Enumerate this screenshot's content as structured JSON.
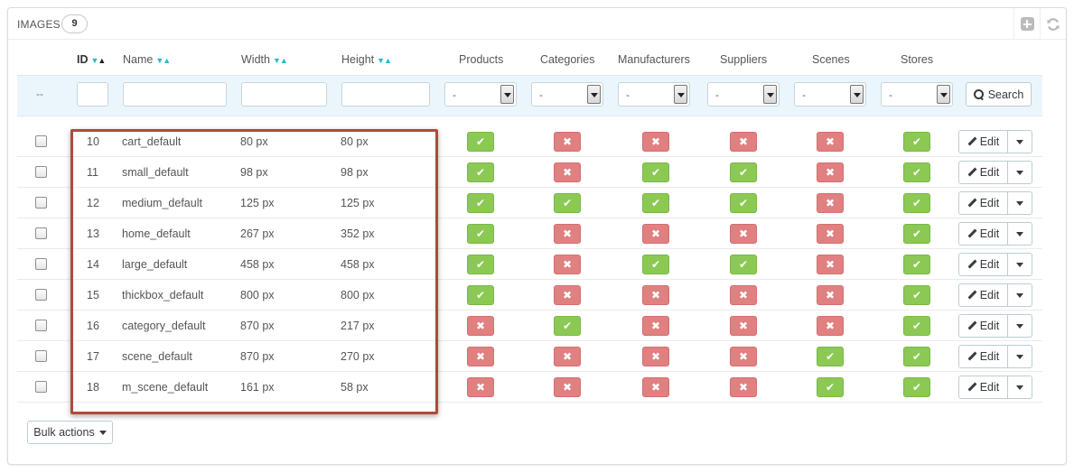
{
  "panel": {
    "title": "IMAGES",
    "count": "9"
  },
  "icons": {
    "add": "plus-icon",
    "refresh": "refresh-icon",
    "search": "search-icon",
    "edit": "pencil-icon",
    "yes": "check-icon",
    "no": "cross-icon"
  },
  "colors": {
    "yes": "#8bc954",
    "no": "#e08080",
    "highlight": "#b14a3a",
    "filter_bg": "#ebf6fc",
    "sort_arrow": "#25b9d7"
  },
  "columns": {
    "id": "ID",
    "name": "Name",
    "width": "Width",
    "height": "Height",
    "products": "Products",
    "categories": "Categories",
    "manufacturers": "Manufacturers",
    "suppliers": "Suppliers",
    "scenes": "Scenes",
    "stores": "Stores"
  },
  "sort_glyphs": {
    "desc": "▼",
    "asc": "▲"
  },
  "filters": {
    "placeholder_dash": "--",
    "select_value": "-",
    "search_label": "Search"
  },
  "row_labels": {
    "edit": "Edit"
  },
  "glyphs": {
    "yes": "✔",
    "no": "✖"
  },
  "rows": [
    {
      "id": "10",
      "name": "cart_default",
      "width": "80 px",
      "height": "80 px",
      "products": true,
      "categories": false,
      "manufacturers": false,
      "suppliers": false,
      "scenes": false,
      "stores": true
    },
    {
      "id": "11",
      "name": "small_default",
      "width": "98 px",
      "height": "98 px",
      "products": true,
      "categories": false,
      "manufacturers": true,
      "suppliers": true,
      "scenes": false,
      "stores": true
    },
    {
      "id": "12",
      "name": "medium_default",
      "width": "125 px",
      "height": "125 px",
      "products": true,
      "categories": true,
      "manufacturers": true,
      "suppliers": true,
      "scenes": false,
      "stores": true
    },
    {
      "id": "13",
      "name": "home_default",
      "width": "267 px",
      "height": "352 px",
      "products": true,
      "categories": false,
      "manufacturers": false,
      "suppliers": false,
      "scenes": false,
      "stores": true
    },
    {
      "id": "14",
      "name": "large_default",
      "width": "458 px",
      "height": "458 px",
      "products": true,
      "categories": false,
      "manufacturers": true,
      "suppliers": true,
      "scenes": false,
      "stores": true
    },
    {
      "id": "15",
      "name": "thickbox_default",
      "width": "800 px",
      "height": "800 px",
      "products": true,
      "categories": false,
      "manufacturers": false,
      "suppliers": false,
      "scenes": false,
      "stores": true
    },
    {
      "id": "16",
      "name": "category_default",
      "width": "870 px",
      "height": "217 px",
      "products": false,
      "categories": true,
      "manufacturers": false,
      "suppliers": false,
      "scenes": false,
      "stores": true
    },
    {
      "id": "17",
      "name": "scene_default",
      "width": "870 px",
      "height": "270 px",
      "products": false,
      "categories": false,
      "manufacturers": false,
      "suppliers": false,
      "scenes": true,
      "stores": true
    },
    {
      "id": "18",
      "name": "m_scene_default",
      "width": "161 px",
      "height": "58 px",
      "products": false,
      "categories": false,
      "manufacturers": false,
      "suppliers": false,
      "scenes": true,
      "stores": true
    }
  ],
  "bulk_actions": {
    "label": "Bulk actions"
  }
}
